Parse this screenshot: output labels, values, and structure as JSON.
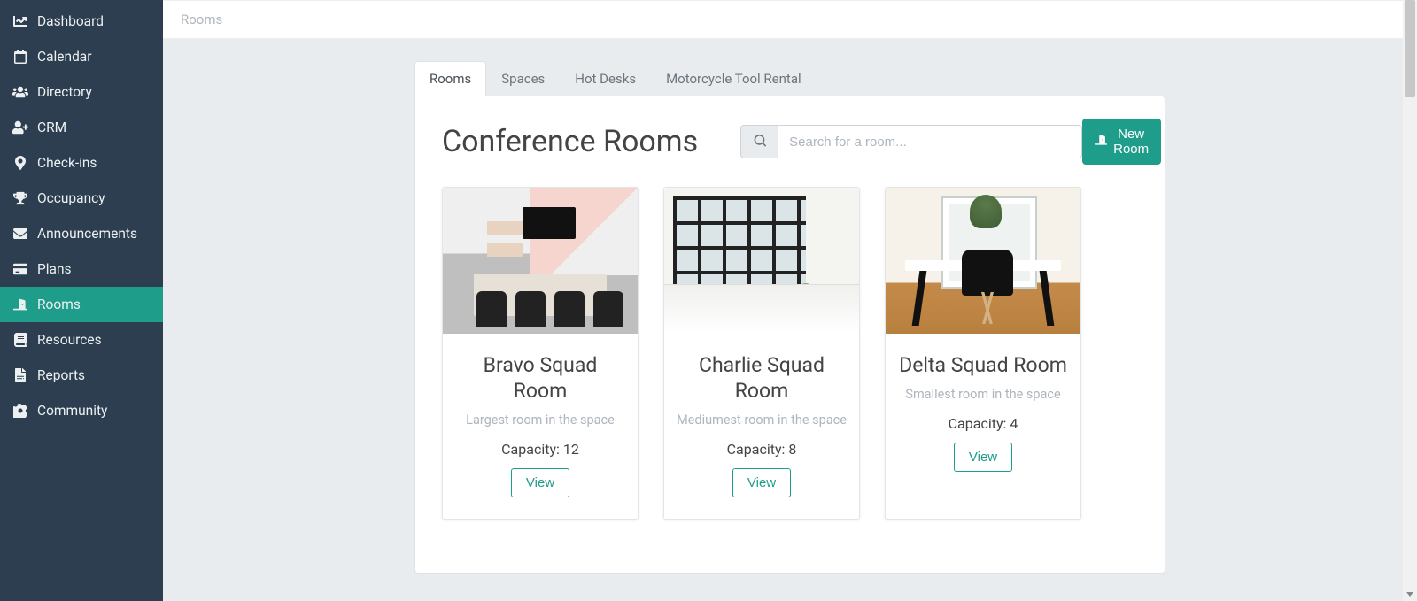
{
  "sidebar": {
    "items": [
      {
        "label": "Dashboard",
        "icon": "dashboard-icon",
        "active": false
      },
      {
        "label": "Calendar",
        "icon": "calendar-icon",
        "active": false
      },
      {
        "label": "Directory",
        "icon": "users-icon",
        "active": false
      },
      {
        "label": "CRM",
        "icon": "user-plus-icon",
        "active": false
      },
      {
        "label": "Check-ins",
        "icon": "map-pin-icon",
        "active": false
      },
      {
        "label": "Occupancy",
        "icon": "trophy-icon",
        "active": false
      },
      {
        "label": "Announcements",
        "icon": "envelope-icon",
        "active": false
      },
      {
        "label": "Plans",
        "icon": "credit-card-icon",
        "active": false
      },
      {
        "label": "Rooms",
        "icon": "door-icon",
        "active": true
      },
      {
        "label": "Resources",
        "icon": "book-icon",
        "active": false
      },
      {
        "label": "Reports",
        "icon": "report-icon",
        "active": false
      },
      {
        "label": "Community",
        "icon": "gear-icon",
        "active": false
      }
    ]
  },
  "breadcrumb": "Rooms",
  "tabs": [
    {
      "label": "Rooms",
      "active": true
    },
    {
      "label": "Spaces",
      "active": false
    },
    {
      "label": "Hot Desks",
      "active": false
    },
    {
      "label": "Motorcycle Tool Rental",
      "active": false
    }
  ],
  "page_title": "Conference Rooms",
  "search": {
    "placeholder": "Search for a room..."
  },
  "new_room_label": "New Room",
  "capacity_prefix": "Capacity: ",
  "view_label": "View",
  "rooms": [
    {
      "name": "Bravo Squad Room",
      "desc": "Largest room in the space",
      "capacity": 12
    },
    {
      "name": "Charlie Squad Room",
      "desc": "Mediumest room in the space",
      "capacity": 8
    },
    {
      "name": "Delta Squad Room",
      "desc": "Smallest room in the space",
      "capacity": 4
    }
  ]
}
